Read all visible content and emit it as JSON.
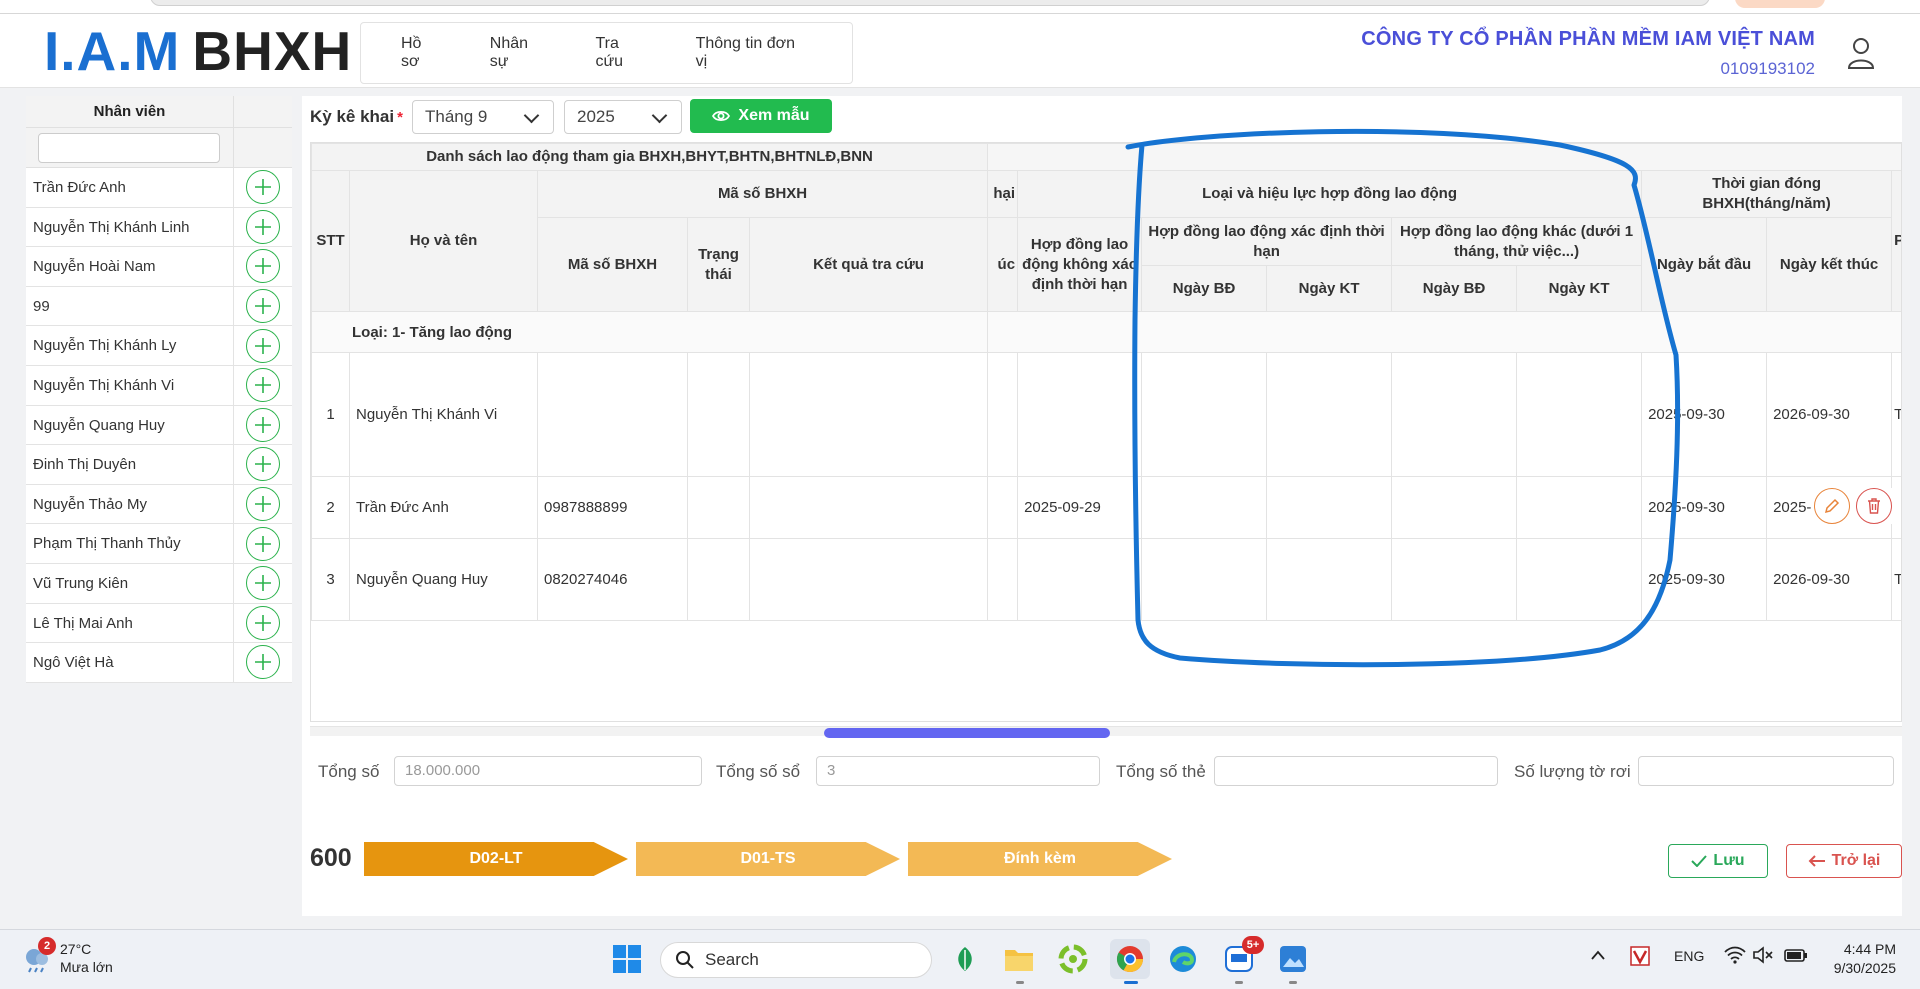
{
  "header": {
    "logo_iam": "I.A.M",
    "logo_bhxh": "BHXH",
    "nav": [
      "Hồ sơ",
      "Nhân sự",
      "Tra cứu",
      "Thông tin đơn vị"
    ],
    "company_name": "CÔNG TY CỔ PHẦN PHẦN MỀM IAM VIỆT NAM",
    "tax_code": "0109193102"
  },
  "sidebar": {
    "title": "Nhân viên",
    "search_value": "",
    "employees": [
      "Trần Đức Anh",
      "Nguyễn Thị Khánh Linh",
      "Nguyễn Hoài Nam",
      "99",
      "Nguyễn Thị Khánh Ly",
      "Nguyễn Thị Khánh Vi",
      "Nguyễn Quang Huy",
      "Đinh Thị Duyên",
      "Nguyễn Thảo My",
      "Phạm Thị Thanh Thủy",
      "Vũ Trung Kiên",
      "Lê Thị Mai Anh",
      "Ngô Việt Hà"
    ]
  },
  "toolbar": {
    "period_label": "Kỳ kê khai",
    "required_mark": "*",
    "month": "Tháng 9",
    "year": "2025",
    "preview_button": "Xem mẫu"
  },
  "table": {
    "group_title": "Danh sách lao động tham gia BHXH,BHYT,BHTN,BHTNLĐ,BNN",
    "h_stt": "STT",
    "h_name": "Họ và tên",
    "h_ma_so_group": "Mã số BHXH",
    "h_ma_so": "Mã số BHXH",
    "h_trang_thai": "Trạng thái",
    "h_ket_qua": "Kết quả tra cứu",
    "h_hai": "hại",
    "h_uc": "úc",
    "h_loai_hd": "Loại và hiệu lực hợp đồng lao động",
    "h_hd_khong_xd": "Hợp đồng lao động không xác định thời hạn",
    "h_hd_xd": "Hợp đồng lao động xác định thời hạn",
    "h_hd_khac": "Hợp đồng lao động khác (dưới 1 tháng, thử việc...)",
    "h_ngay_bd": "Ngày BĐ",
    "h_ngay_kt": "Ngày KT",
    "h_tg_dong": "Thời gian đóng BHXH(tháng/năm)",
    "h_ngay_bat_dau": "Ngày bắt đầu",
    "h_ngay_ket_thuc": "Ngày kết thúc",
    "h_cut": "P",
    "section_label": "Loại: 1- Tăng lao động",
    "rows": [
      {
        "stt": "1",
        "name": "Nguyễn Thị Khánh Vi",
        "ma_so": "",
        "hd_khong_xd": "",
        "start": "2025-09-30",
        "end": "2026-09-30",
        "cut": "T"
      },
      {
        "stt": "2",
        "name": "Trần Đức Anh",
        "ma_so": "0987888899",
        "hd_khong_xd": "2025-09-29",
        "start": "2025-09-30",
        "end": "2025-",
        "cut": ""
      },
      {
        "stt": "3",
        "name": "Nguyễn Quang Huy",
        "ma_so": "0820274046",
        "hd_khong_xd": "",
        "start": "2025-09-30",
        "end": "2026-09-30",
        "cut": "T"
      }
    ]
  },
  "totals": {
    "tong_so_label": "Tổng số",
    "tong_so_value": "18.000.000",
    "tong_so_so_label": "Tổng số sổ",
    "tong_so_so_value": "3",
    "tong_so_the_label": "Tổng số thẻ",
    "tong_so_the_value": "",
    "so_luong_label": "Số lượng tờ rơi",
    "so_luong_value": ""
  },
  "footer": {
    "number": "600",
    "steps": [
      "D02-LT",
      "D01-TS",
      "Đính kèm"
    ],
    "save": "Lưu",
    "back": "Trở lại"
  },
  "taskbar": {
    "weather_badge": "2",
    "temperature": "27°C",
    "weather_desc": "Mưa lớn",
    "search_placeholder": "Search",
    "zalo_badge": "5+",
    "lang": "ENG",
    "time": "4:44 PM",
    "date": "9/30/2025"
  },
  "colors": {
    "brand_blue": "#1a6fd1",
    "company_purple": "#4a4fd8",
    "green": "#22bb4f",
    "step_active": "#e6950f",
    "step_inactive": "#f3b955",
    "annotation_blue": "#1673d1"
  }
}
